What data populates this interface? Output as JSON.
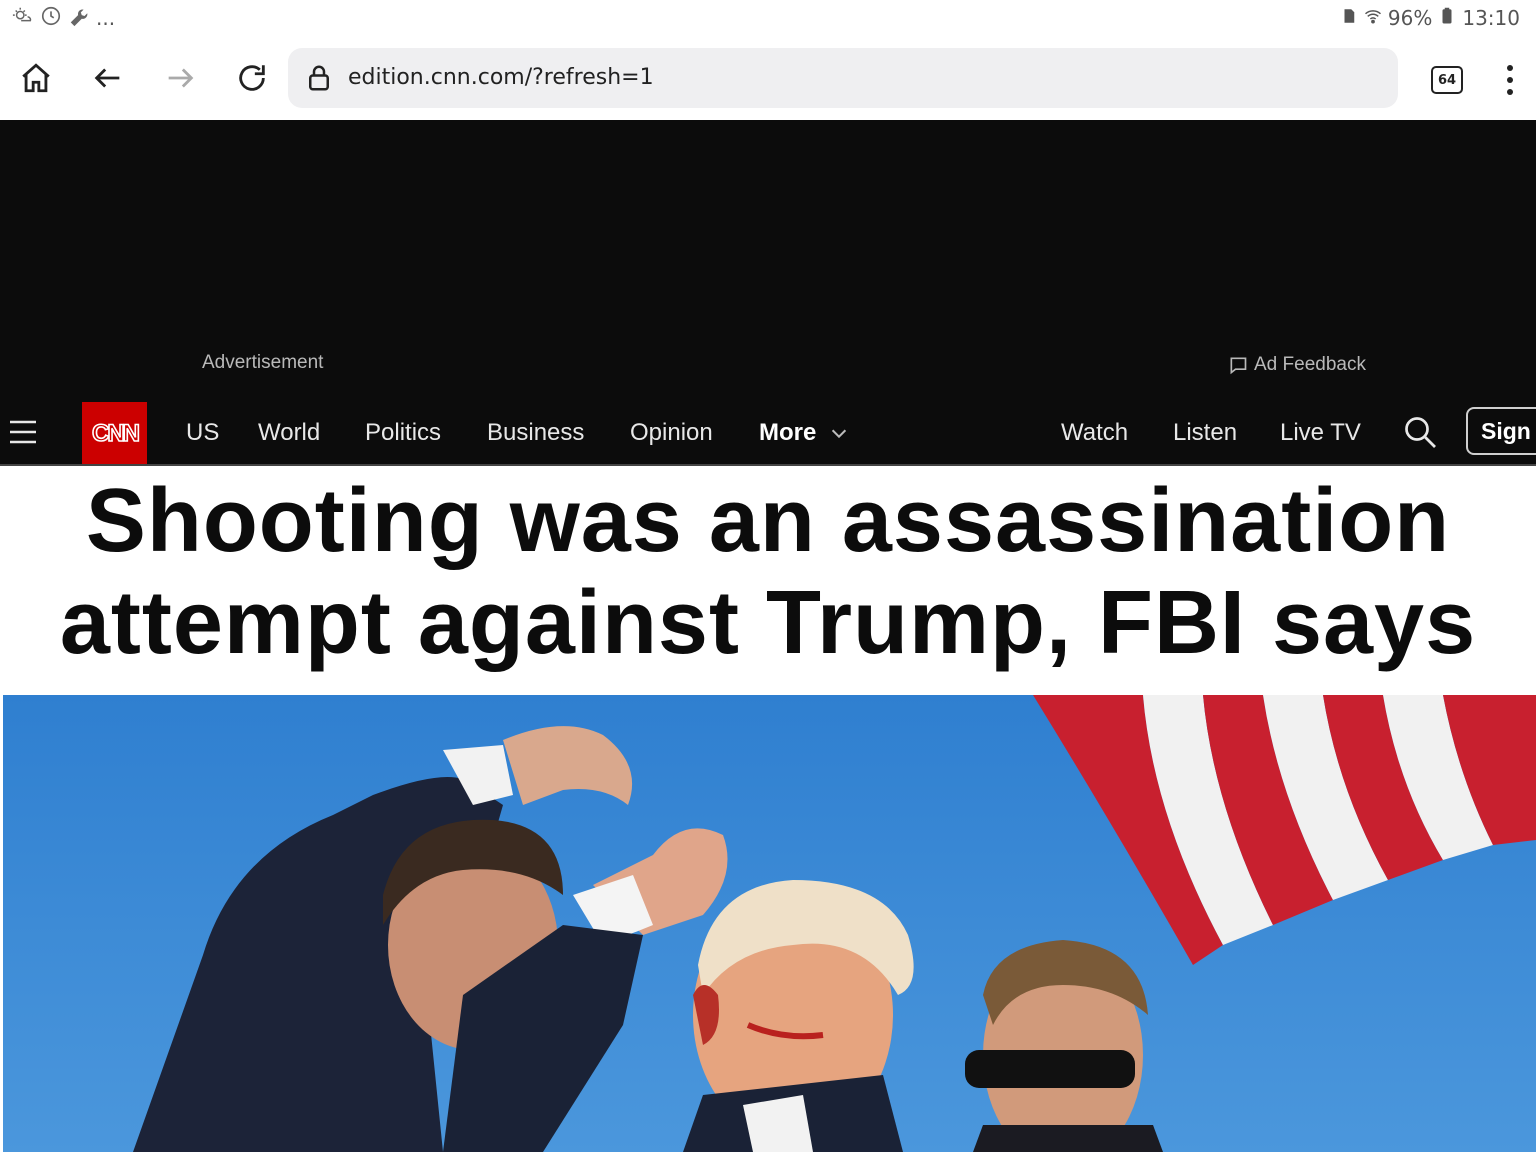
{
  "status_bar": {
    "left_icons": [
      "weather-icon",
      "sync-icon",
      "wrench-icon"
    ],
    "overflow": "...",
    "battery_percent": "96%",
    "time": "13:10"
  },
  "browser": {
    "url": "edition.cnn.com/?refresh=1",
    "tab_count": "64"
  },
  "ad": {
    "label": "Advertisement",
    "feedback": "Ad Feedback"
  },
  "nav": {
    "logo": "CNN",
    "items": [
      "US",
      "World",
      "Politics",
      "Business",
      "Opinion"
    ],
    "more": "More",
    "right_items": [
      "Watch",
      "Listen",
      "Live TV"
    ],
    "sign_in": "Sign"
  },
  "headline": {
    "line1": "Shooting was an assassination",
    "line2": "attempt against Trump, FBI says"
  },
  "colors": {
    "cnn_red": "#cc0000",
    "nav_bg": "#0c0c0c",
    "sky": "#3d8ad6"
  }
}
